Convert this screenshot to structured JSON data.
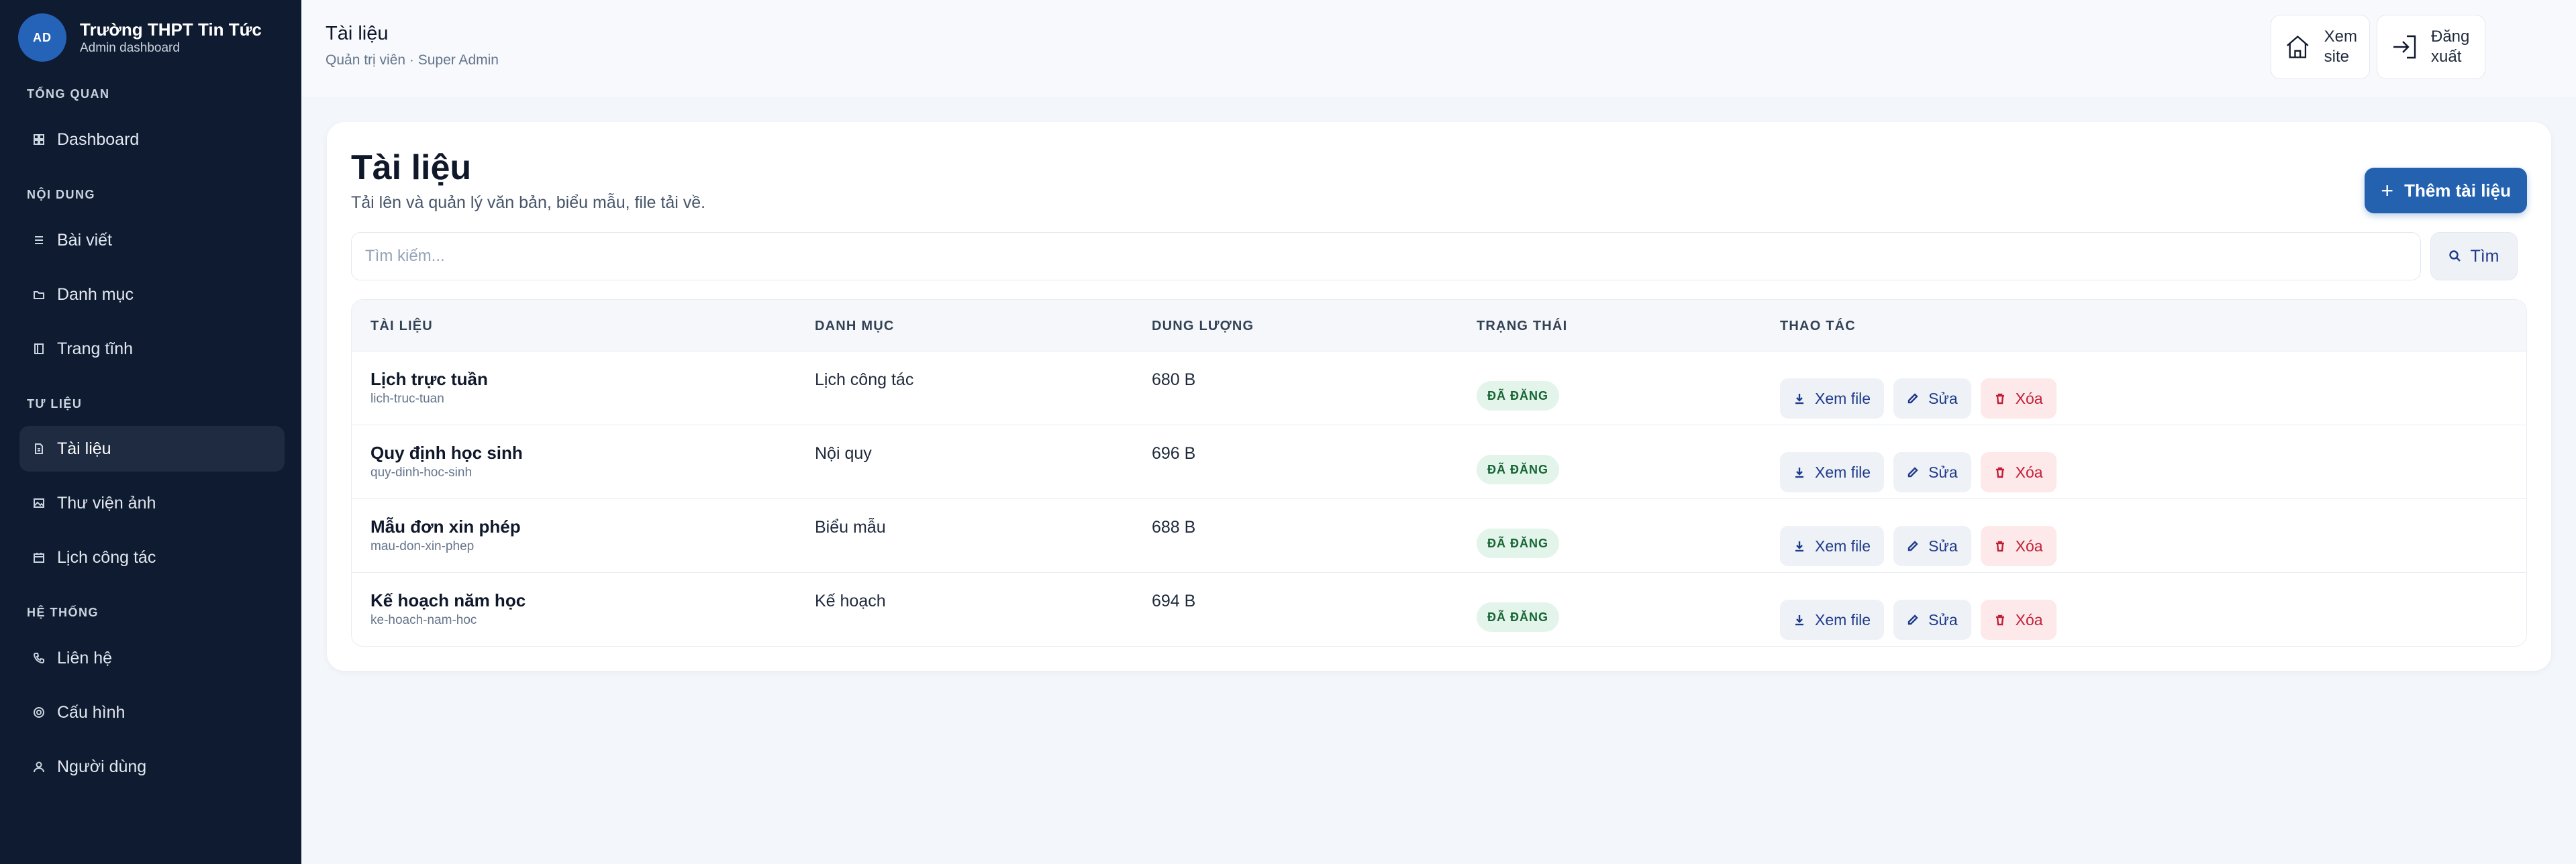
{
  "brand": {
    "avatar": "AD",
    "title": "Trường THPT Tin Tức",
    "subtitle": "Admin dashboard"
  },
  "sidebar": {
    "sections": [
      {
        "label": "TỔNG QUAN",
        "items": [
          {
            "label": "Dashboard",
            "icon": "dashboard-icon"
          }
        ]
      },
      {
        "label": "NỘI DUNG",
        "items": [
          {
            "label": "Bài viết",
            "icon": "list-icon"
          },
          {
            "label": "Danh mục",
            "icon": "folder-icon"
          },
          {
            "label": "Trang tĩnh",
            "icon": "page-icon"
          }
        ]
      },
      {
        "label": "TƯ LIỆU",
        "items": [
          {
            "label": "Tài liệu",
            "icon": "document-icon",
            "active": true
          },
          {
            "label": "Thư viện ảnh",
            "icon": "image-icon"
          },
          {
            "label": "Lịch công tác",
            "icon": "calendar-icon"
          }
        ]
      },
      {
        "label": "HỆ THỐNG",
        "items": [
          {
            "label": "Liên hệ",
            "icon": "phone-icon"
          },
          {
            "label": "Cấu hình",
            "icon": "gear-icon"
          },
          {
            "label": "Người dùng",
            "icon": "user-icon"
          }
        ]
      }
    ]
  },
  "header": {
    "title": "Tài liệu",
    "subtitle": "Quản trị viên · Super Admin",
    "view_site_line1": "Xem",
    "view_site_line2": "site",
    "logout_line1": "Đăng",
    "logout_line2": "xuất"
  },
  "main": {
    "title": "Tài liệu",
    "subtitle": "Tải lên và quản lý văn bản, biểu mẫu, file tải về.",
    "add_button": "Thêm tài liệu",
    "search_placeholder": "Tìm kiếm...",
    "search_button": "Tìm",
    "columns": [
      "TÀI LIỆU",
      "DANH MỤC",
      "DUNG LƯỢNG",
      "TRẠNG THÁI",
      "THAO TÁC"
    ],
    "rows": [
      {
        "title": "Lịch trực tuần",
        "slug": "lich-truc-tuan",
        "category": "Lịch công tác",
        "size": "680 B",
        "status": "ĐÃ ĐĂNG"
      },
      {
        "title": "Quy định học sinh",
        "slug": "quy-dinh-hoc-sinh",
        "category": "Nội quy",
        "size": "696 B",
        "status": "ĐÃ ĐĂNG"
      },
      {
        "title": "Mẫu đơn xin phép",
        "slug": "mau-don-xin-phep",
        "category": "Biểu mẫu",
        "size": "688 B",
        "status": "ĐÃ ĐĂNG"
      },
      {
        "title": "Kế hoạch năm học",
        "slug": "ke-hoach-nam-hoc",
        "category": "Kế hoạch",
        "size": "694 B",
        "status": "ĐÃ ĐĂNG"
      }
    ],
    "actions": {
      "view": "Xem file",
      "edit": "Sửa",
      "delete": "Xóa"
    }
  },
  "colors": {
    "sidebar_bg": "#0f1b30",
    "accent": "#2462b0",
    "success_badge": "#e3f4ea",
    "danger": "#c21f36"
  }
}
